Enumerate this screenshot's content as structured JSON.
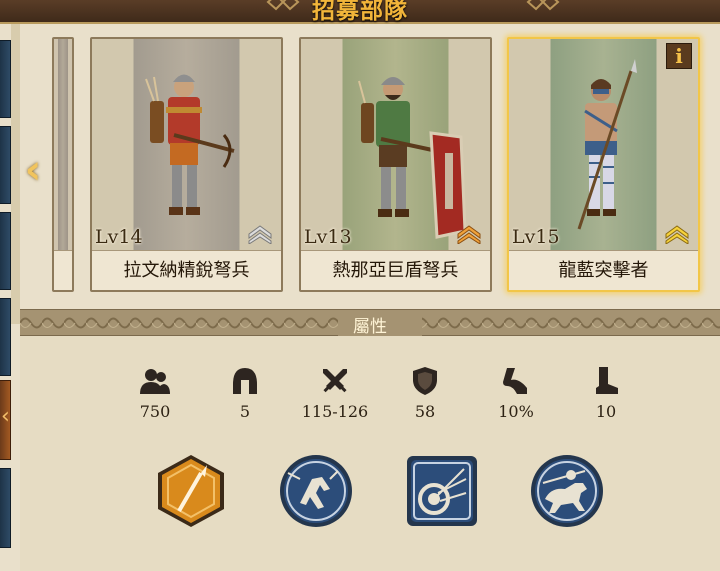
{
  "header": {
    "title": "招募部隊"
  },
  "cards": [
    {
      "name": "拉文納精銳弩兵",
      "level": "Lv14",
      "rank": "silver"
    },
    {
      "name": "熱那亞巨盾弩兵",
      "level": "Lv13",
      "rank": "orange"
    },
    {
      "name": "龍藍突擊者",
      "level": "Lv15",
      "rank": "gold",
      "selected": true,
      "info_label": "i"
    }
  ],
  "attributes": {
    "label": "屬性",
    "stats": [
      {
        "icon": "troops-icon",
        "value": "750"
      },
      {
        "icon": "helmet-icon",
        "value": "5"
      },
      {
        "icon": "crossed-swords-icon",
        "value": "115-126"
      },
      {
        "icon": "shield-icon",
        "value": "58"
      },
      {
        "icon": "charge-icon",
        "value": "10%"
      },
      {
        "icon": "boot-icon",
        "value": "10"
      }
    ],
    "skills": [
      {
        "icon": "spear-skill-icon",
        "color": "#d98a1c"
      },
      {
        "icon": "charge-skill-icon",
        "color": "#2c4d7a"
      },
      {
        "icon": "volley-skill-icon",
        "color": "#2c4d7a"
      },
      {
        "icon": "cavalry-skill-icon",
        "color": "#2c4d7a"
      }
    ]
  },
  "colors": {
    "accent_gold": "#f2b53a",
    "header_brown": "#4a321f",
    "panel_beige": "#e6dcc3"
  }
}
